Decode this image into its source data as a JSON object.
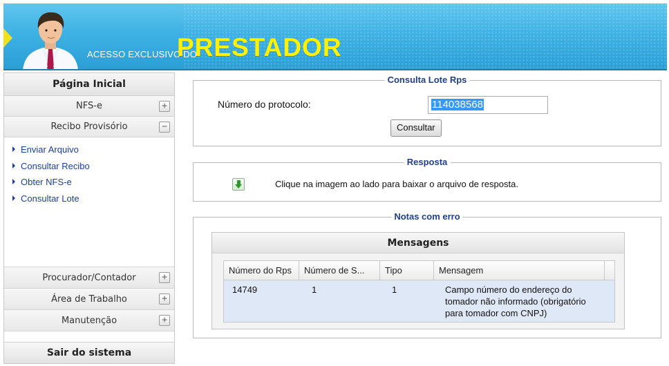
{
  "header": {
    "access_text": "ACESSO EXCLUSIVO DO",
    "brand": "PRESTADOR",
    "avatar_icon": "user-avatar-icon",
    "colors": {
      "banner": "#3fb2e4",
      "brand": "#fff200",
      "arrow": "#f2e11a"
    }
  },
  "sidebar": {
    "home": "Página Inicial",
    "nfse": "NFS-e",
    "recibo": "Recibo Provisório",
    "links": [
      "Enviar Arquivo",
      "Consultar Recibo",
      "Obter NFS-e",
      "Consultar Lote"
    ],
    "procurador": "Procurador/Contador",
    "area": "Área de Trabalho",
    "manutencao": "Manutenção",
    "sair": "Sair do sistema",
    "expand_symbol": "+",
    "collapse_symbol": "−"
  },
  "consulta": {
    "legend": "Consulta Lote Rps",
    "protocol_label": "Número do protocolo:",
    "protocol_value": "114038568",
    "button": "Consultar"
  },
  "resposta": {
    "legend": "Resposta",
    "text": "Clique na imagem ao lado para baixar o arquivo de resposta.",
    "icon": "download-icon"
  },
  "notas": {
    "legend": "Notas com erro",
    "grid_title": "Mensagens",
    "columns": [
      "Número do Rps",
      "Número de S...",
      "Tipo",
      "Mensagem"
    ],
    "rows": [
      {
        "numero_rps": "14749",
        "numero_serie": "1",
        "tipo": "1",
        "mensagem": [
          "Campo número do endereço do",
          "tomador não informado (obrigatório",
          "para tomador com CNPJ)"
        ]
      }
    ]
  }
}
